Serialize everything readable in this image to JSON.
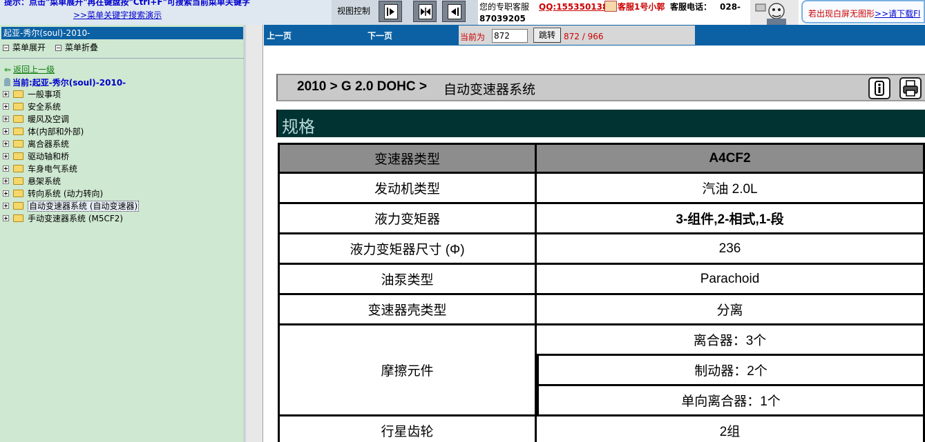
{
  "topbar": {
    "tip_text": "提示：点击\"菜单展开\"再在键盘按\"Ctrl+F\"可搜索当前菜单关键字",
    "tip_link": ">>菜单关键字搜索演示",
    "view_control_label": "视图控制",
    "service_label": "您的专职客服",
    "service_qq": "QQ:1553501388",
    "service_agent": "客服1号小郭",
    "service_phone_label": "客服电话：",
    "service_phone_part1": "028-",
    "service_phone_part2": "87039205",
    "notice_text": "若出现白屏无图形",
    "notice_link": ">>请下载Fl"
  },
  "sidebar": {
    "title": "起亚-秀尔(soul)-2010-",
    "expand_label": "菜单展开",
    "collapse_label": "菜单折叠",
    "back_label": "返回上一级",
    "current_label": "当前:起亚-秀尔(soul)-2010-",
    "tree_items": [
      {
        "label": "一般事项"
      },
      {
        "label": "安全系统"
      },
      {
        "label": "暖风及空调"
      },
      {
        "label": "体(内部和外部)"
      },
      {
        "label": "离合器系统"
      },
      {
        "label": "驱动轴和桥"
      },
      {
        "label": "车身电气系统"
      },
      {
        "label": "悬架系统"
      },
      {
        "label": "转向系统 (动力转向)"
      },
      {
        "label": "自动变速器系统 (自动变速器)"
      },
      {
        "label": "手动变速器系统 (M5CF2)"
      }
    ],
    "selected_index": 9
  },
  "navbar": {
    "prev_label": "上一页",
    "next_label": "下一页",
    "current_label": "当前为",
    "page_value": "872",
    "jump_label": "跳转",
    "page_count": "872 / 966"
  },
  "content": {
    "crumb_path": "2010 > G 2.0 DOHC >",
    "crumb_section": "自动变速器系统",
    "section_title": "规格",
    "spec_header": {
      "label": "变速器类型",
      "value": "A4CF2"
    },
    "rows": [
      {
        "label": "发动机类型",
        "value": "汽油 2.0L"
      },
      {
        "label": "液力变矩器",
        "value": "3-组件,2-相式,1-段"
      },
      {
        "label": "液力变矩器尺寸 (Φ)",
        "value": "236"
      },
      {
        "label": "油泵类型",
        "value": "Parachoid"
      },
      {
        "label": "变速器壳类型",
        "value": "分离"
      }
    ],
    "friction": {
      "label": "摩擦元件",
      "values": [
        "离合器：3个",
        "制动器：2个",
        "单向离合器：1个"
      ]
    },
    "planetary": {
      "label": "行星齿轮",
      "value": "2组"
    }
  },
  "colors": {
    "nav_blue": "#0b61a4",
    "sidebar_green": "#cfe8d1",
    "section_dark_teal": "#023333",
    "header_gray": "#8d8d8d"
  }
}
